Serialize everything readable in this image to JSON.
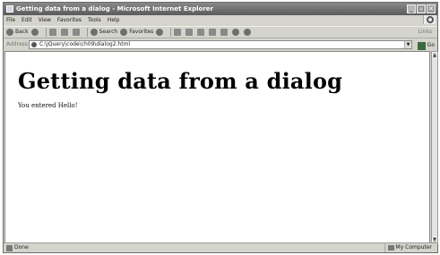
{
  "window": {
    "title": "Getting data from a dialog - Microsoft Internet Explorer",
    "controls": {
      "minimize": "_",
      "maximize": "□",
      "close": "✕"
    }
  },
  "menubar": [
    "File",
    "Edit",
    "View",
    "Favorites",
    "Tools",
    "Help"
  ],
  "toolbar": {
    "back": "Back",
    "search": "Search",
    "favorites": "Favorites",
    "links": "Links"
  },
  "addressbar": {
    "label": "Address",
    "url": "C:\\jQuery\\code\\ch09\\dialog2.html",
    "go": "Go"
  },
  "page": {
    "heading": "Getting data from a dialog",
    "message": "You entered Hello!"
  },
  "statusbar": {
    "status": "Done",
    "zone": "My Computer"
  }
}
